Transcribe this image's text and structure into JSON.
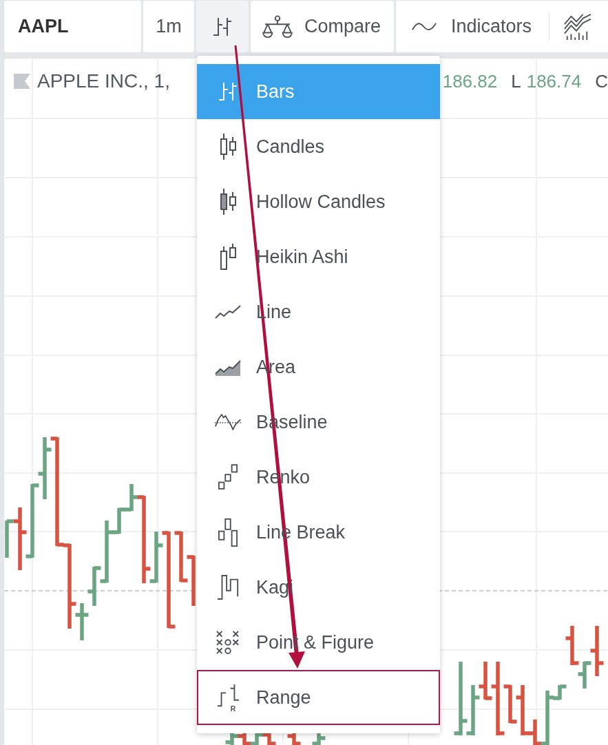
{
  "toolbar": {
    "items": [
      {
        "kind": "symbol",
        "label": "AAPL",
        "active": false
      },
      {
        "kind": "interval",
        "label": "1m",
        "active": false
      },
      {
        "kind": "chart_type",
        "active": true
      },
      {
        "kind": "compare",
        "label": "Compare",
        "active": false
      },
      {
        "kind": "indicators",
        "label": "Indicators",
        "active": false
      },
      {
        "kind": "financials",
        "active": false
      }
    ]
  },
  "legend": {
    "title": "APPLE INC., 1,",
    "values": [
      {
        "kind": "value",
        "text": "186.82"
      },
      {
        "kind": "label",
        "text": "L"
      },
      {
        "kind": "value",
        "text": "186.74"
      },
      {
        "kind": "label",
        "text": "C"
      }
    ]
  },
  "chart_type_menu": {
    "items": [
      {
        "kind": "bars",
        "label": "Bars",
        "selected": true,
        "highlighted": false
      },
      {
        "kind": "candles",
        "label": "Candles",
        "selected": false,
        "highlighted": false
      },
      {
        "kind": "hollow_candles",
        "label": "Hollow Candles",
        "selected": false,
        "highlighted": false
      },
      {
        "kind": "heikin_ashi",
        "label": "Heikin Ashi",
        "selected": false,
        "highlighted": false
      },
      {
        "kind": "line",
        "label": "Line",
        "selected": false,
        "highlighted": false
      },
      {
        "kind": "area",
        "label": "Area",
        "selected": false,
        "highlighted": false
      },
      {
        "kind": "baseline",
        "label": "Baseline",
        "selected": false,
        "highlighted": false
      },
      {
        "kind": "renko",
        "label": "Renko",
        "selected": false,
        "highlighted": false
      },
      {
        "kind": "line_break",
        "label": "Line Break",
        "selected": false,
        "highlighted": false
      },
      {
        "kind": "kagi",
        "label": "Kagi",
        "selected": false,
        "highlighted": false
      },
      {
        "kind": "point_figure",
        "label": "Point & Figure",
        "selected": false,
        "highlighted": false
      },
      {
        "kind": "range",
        "label": "Range",
        "icon_letter": "R",
        "selected": false,
        "highlighted": true
      }
    ]
  },
  "annotation": {
    "arrow": true
  }
}
